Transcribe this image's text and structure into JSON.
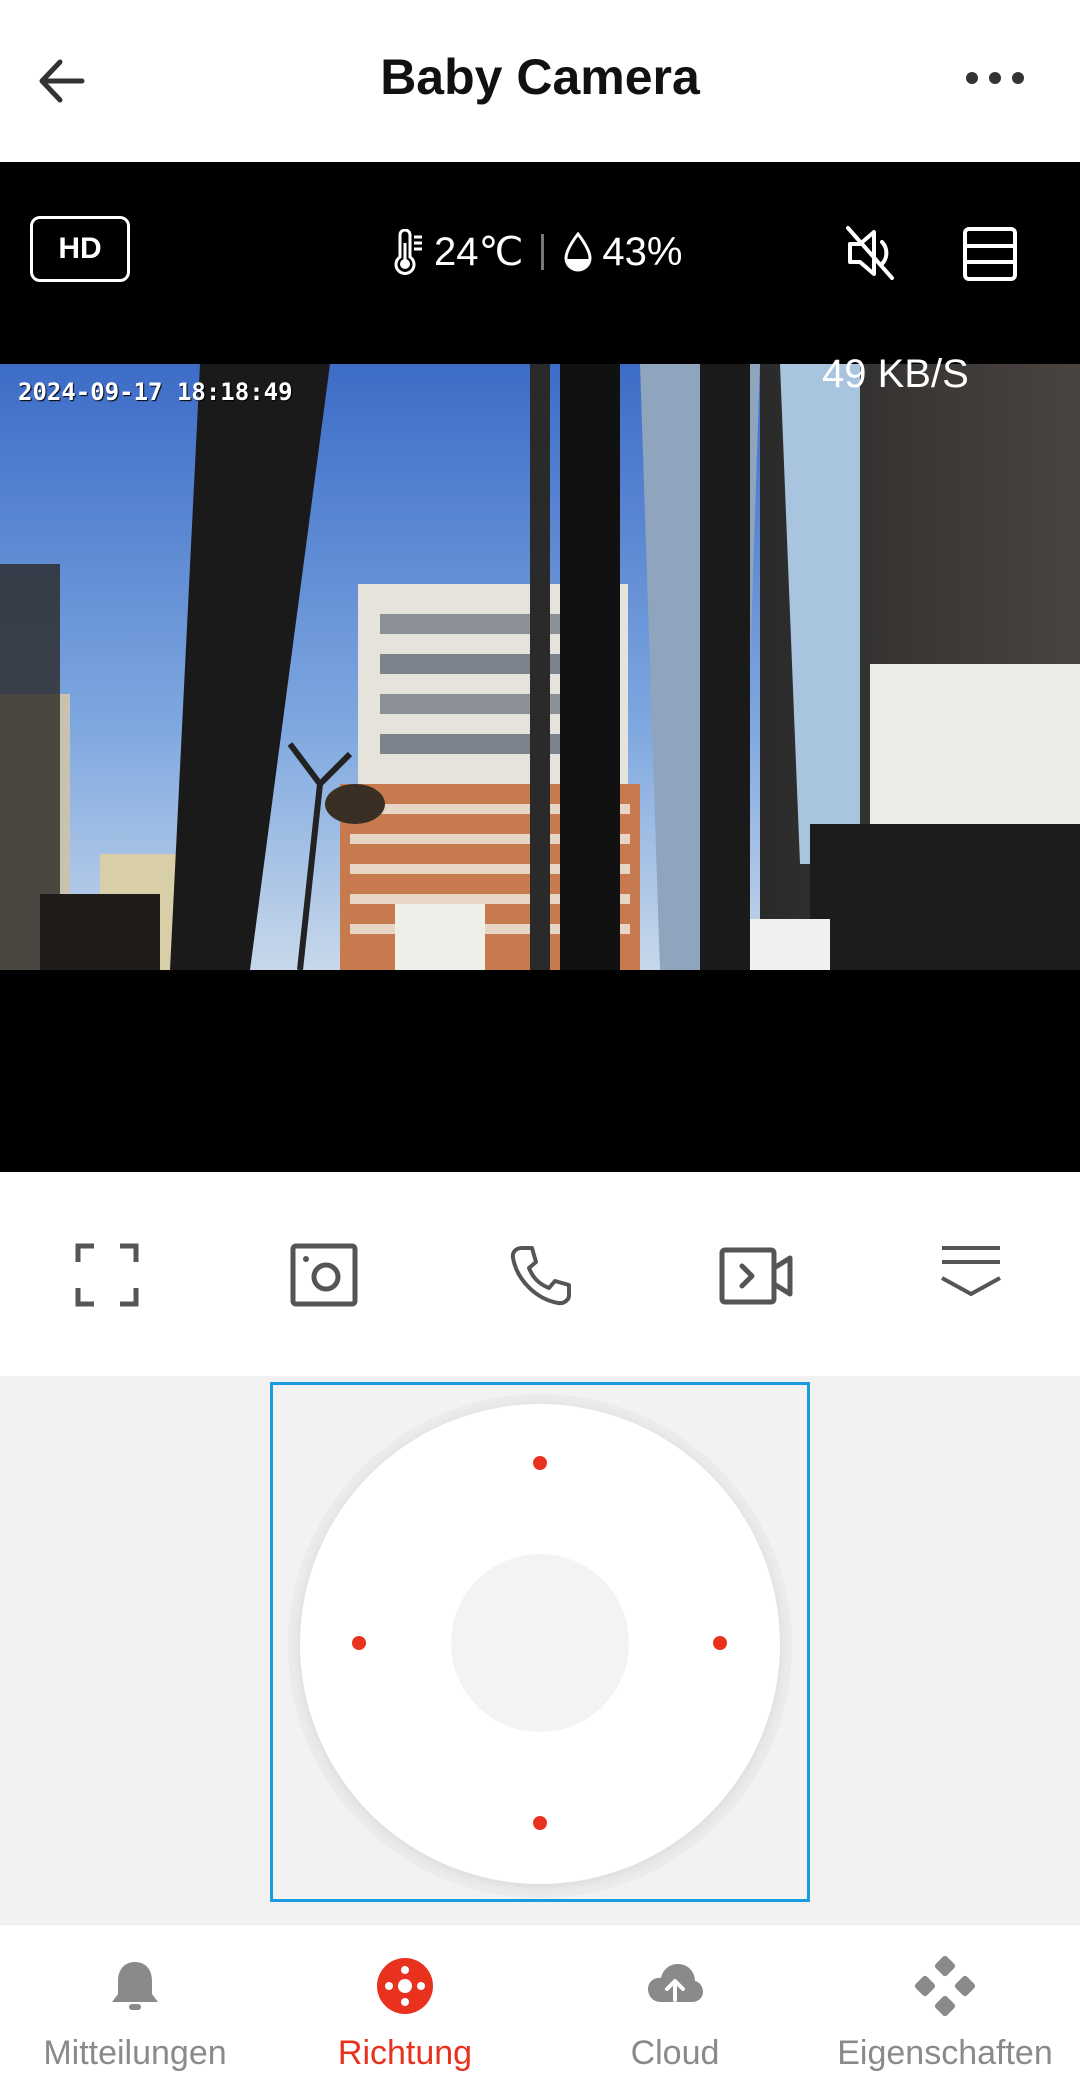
{
  "header": {
    "title": "Baby Camera",
    "back_icon": "arrow-left-icon",
    "more_icon": "more-horizontal-icon"
  },
  "video": {
    "quality_label": "HD",
    "temperature": "24℃",
    "humidity": "43%",
    "timestamp": "2024-09-17 18:18:49",
    "bitrate": "49 KB/S",
    "mute_icon": "speaker-muted-icon",
    "layout_icon": "list-layout-icon"
  },
  "actions": [
    {
      "name": "fullscreen",
      "icon": "fullscreen-icon"
    },
    {
      "name": "screenshot",
      "icon": "camera-photo-icon"
    },
    {
      "name": "call",
      "icon": "phone-icon"
    },
    {
      "name": "record",
      "icon": "video-record-icon"
    },
    {
      "name": "more",
      "icon": "chevron-panel-icon"
    }
  ],
  "tabs": [
    {
      "label": "Mitteilungen",
      "icon": "bell-icon",
      "active": false
    },
    {
      "label": "Richtung",
      "icon": "direction-icon",
      "active": true
    },
    {
      "label": "Cloud",
      "icon": "cloud-upload-icon",
      "active": false
    },
    {
      "label": "Eigenschaften",
      "icon": "features-icon",
      "active": false
    }
  ],
  "colors": {
    "accent": "#e8321e",
    "selection_border": "#1a9de0",
    "inactive": "#8a8a8a"
  }
}
